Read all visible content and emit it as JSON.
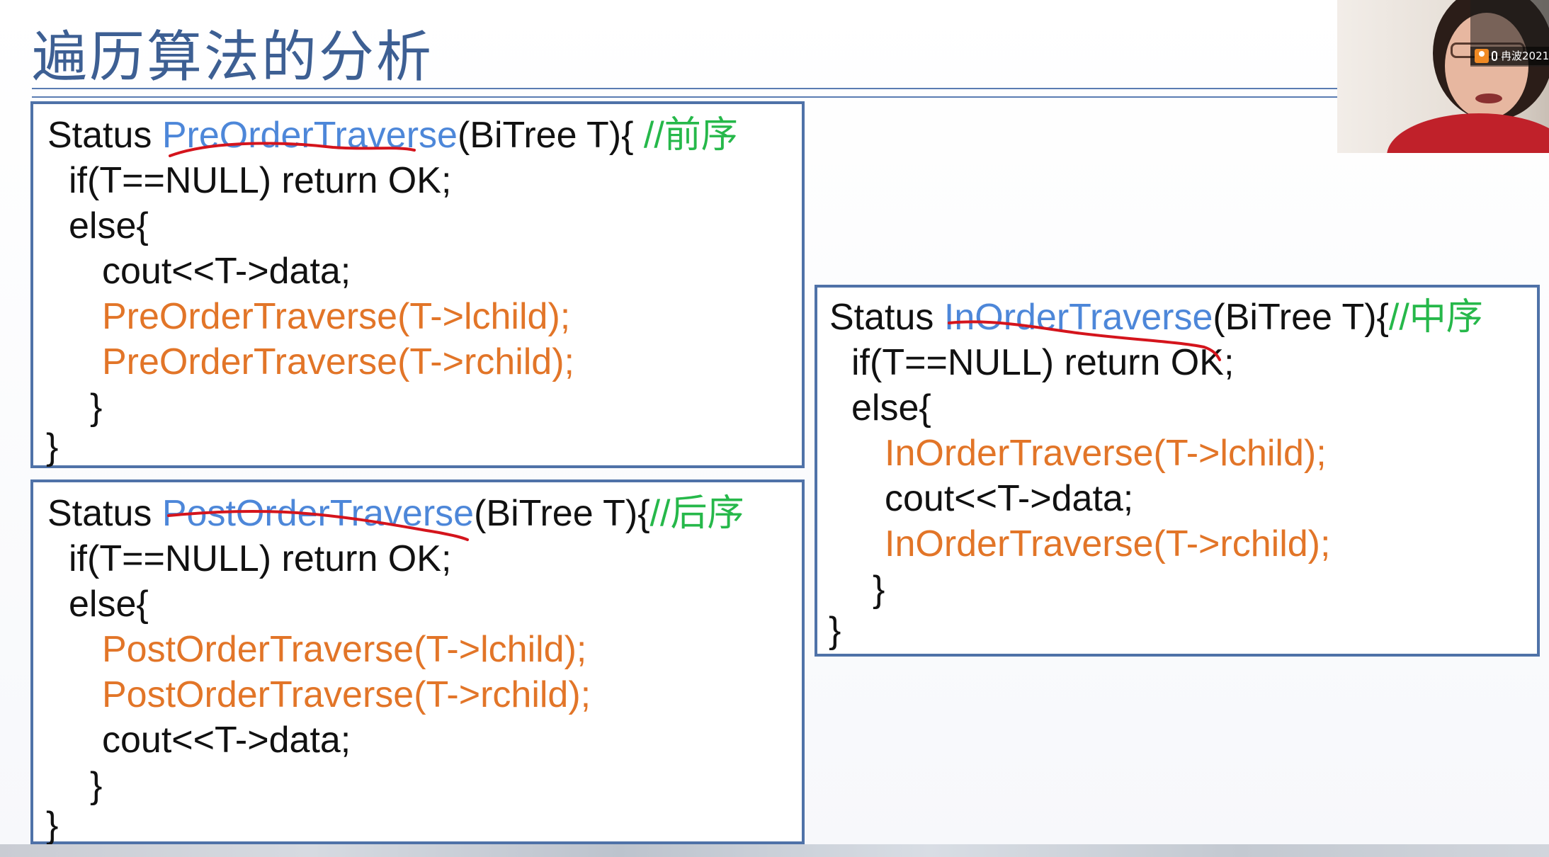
{
  "slide": {
    "title": "遍历算法的分析"
  },
  "preorder": {
    "line1": {
      "prefix": "Status ",
      "fn": "PreOrderTraverse",
      "args": "(BiTree T){ ",
      "comment": "//前序"
    },
    "line2": "if(T==NULL) return OK;",
    "line3": "else{",
    "line4": "cout<<T->data;",
    "line5": "PreOrderTraverse(T->lchild);",
    "line6": "PreOrderTraverse(T->rchild);",
    "line7": "}",
    "line8": "}"
  },
  "postorder": {
    "line1": {
      "prefix": "Status ",
      "fn": "PostOrderTraverse",
      "args": "(BiTree T){",
      "comment": "//后序"
    },
    "line2": "if(T==NULL) return OK;",
    "line3": "else{",
    "line4": "PostOrderTraverse(T->lchild);",
    "line5": "PostOrderTraverse(T->rchild);",
    "line6": "cout<<T->data;",
    "line7": "}",
    "line8": "}"
  },
  "inorder": {
    "line1": {
      "prefix": "Status ",
      "fn": "InOrderTraverse",
      "args": "(BiTree T){",
      "comment": "//中序"
    },
    "line2": "if(T==NULL) return OK;",
    "line3": "else{",
    "line4": "InOrderTraverse(T->lchild);",
    "line5": "cout<<T->data;",
    "line6": "InOrderTraverse(T->rchild);",
    "line7": "}",
    "line8": "}"
  },
  "colors": {
    "title": "#3d5f93",
    "function_name": "#4d87d9",
    "recursive_call": "#e27528",
    "comment": "#26b84a",
    "annotation_ink": "#d4141c",
    "box_border": "#4f72a8"
  },
  "webcam": {
    "participant_name": "冉波2021"
  }
}
